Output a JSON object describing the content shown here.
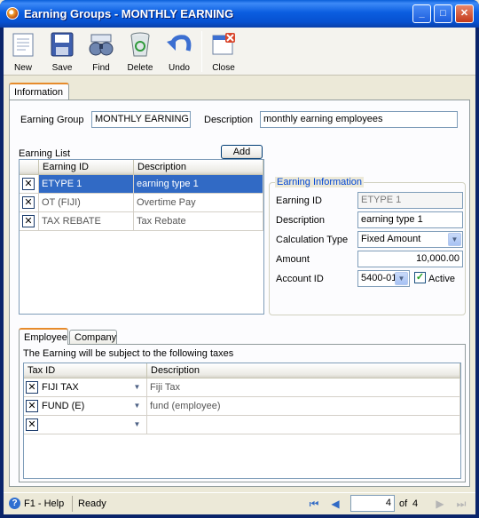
{
  "window": {
    "title": "Earning Groups - MONTHLY EARNING"
  },
  "toolbar": {
    "new": "New",
    "save": "Save",
    "find": "Find",
    "delete": "Delete",
    "undo": "Undo",
    "close": "Close"
  },
  "tabs": {
    "information": "Information"
  },
  "header": {
    "earning_group_label": "Earning Group",
    "earning_group_value": "MONTHLY EARNING",
    "description_label": "Description",
    "description_value": "monthly earning employees"
  },
  "earning_list": {
    "title": "Earning List",
    "add_label": "Add",
    "columns": [
      "Earning ID",
      "Description"
    ],
    "rows": [
      {
        "id": "ETYPE 1",
        "description": "earning type 1",
        "selected": true
      },
      {
        "id": "OT (FIJI)",
        "description": "Overtime Pay",
        "selected": false
      },
      {
        "id": "TAX REBATE",
        "description": "Tax Rebate",
        "selected": false
      }
    ]
  },
  "earning_info": {
    "title": "Earning Information",
    "earning_id_label": "Earning ID",
    "earning_id_value": "ETYPE 1",
    "description_label": "Description",
    "description_value": "earning type 1",
    "calc_type_label": "Calculation Type",
    "calc_type_value": "Fixed Amount",
    "amount_label": "Amount",
    "amount_value": "10,000.00",
    "account_label": "Account ID",
    "account_value": "5400-01",
    "active_label": "Active",
    "active_checked": true
  },
  "subtabs": {
    "employee": "Employee",
    "company": "Company"
  },
  "taxes": {
    "caption": "The Earning will be subject to the following taxes",
    "columns": [
      "Tax ID",
      "Description"
    ],
    "rows": [
      {
        "id": "FIJI TAX",
        "description": "Fiji Tax"
      },
      {
        "id": "FUND (E)",
        "description": "fund (employee)"
      },
      {
        "id": "",
        "description": ""
      }
    ]
  },
  "status": {
    "help": "F1 - Help",
    "state": "Ready",
    "record_current": "4",
    "of_label": "of",
    "record_total": "4"
  }
}
